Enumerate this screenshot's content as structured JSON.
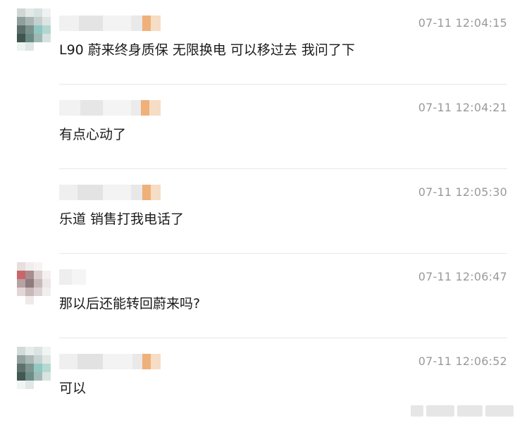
{
  "messages": [
    {
      "time": "07-11 12:04:15",
      "text": "L90 蔚来终身质保 无限换电 可以移过去 我问了下",
      "avatar": "user-avatar"
    },
    {
      "time": "07-11 12:04:21",
      "text": "有点心动了",
      "avatar": "none"
    },
    {
      "time": "07-11 12:05:30",
      "text": "乐道 销售打我电话了",
      "avatar": "none"
    },
    {
      "time": "07-11 12:06:47",
      "text": "那以后还能转回蔚来吗?",
      "avatar": "user-avatar"
    },
    {
      "time": "07-11 12:06:52",
      "text": "可以",
      "avatar": "user-avatar"
    }
  ]
}
